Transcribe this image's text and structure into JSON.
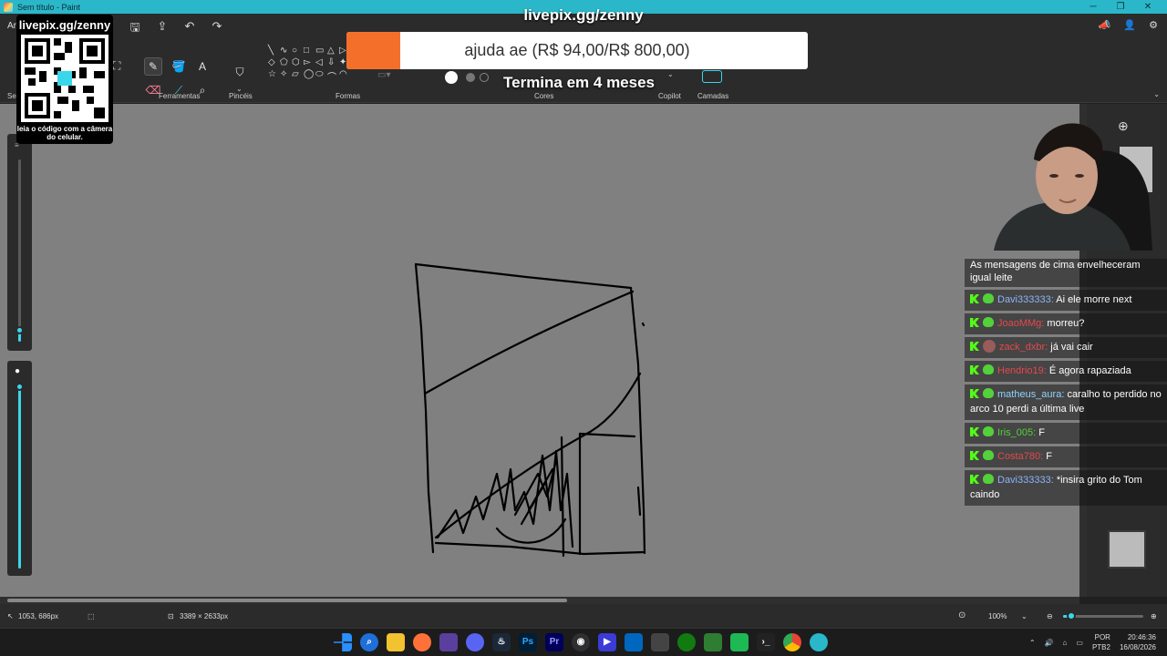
{
  "window": {
    "title": "Sem título - Paint",
    "minimize": "─",
    "maximize": "❐",
    "close": "✕"
  },
  "ribbon": {
    "file_menu_fragment": "Ar",
    "select_label_fragment": "Sel",
    "groups": {
      "tools": "Ferramentas",
      "brushes": "Pincéis",
      "shapes": "Formas",
      "colors": "Cores",
      "copilot": "Copilot",
      "layers": "Camadas"
    },
    "shape_glyphs": [
      "╲",
      "∿",
      "○",
      "□",
      "▭",
      "△",
      "▷",
      "◇",
      "⬠",
      "⬡",
      "▻",
      "◁",
      "⇩",
      "✦",
      "☆",
      "✧",
      "▱",
      "◯",
      "⬭",
      "⌒",
      "◠"
    ]
  },
  "qr_overlay": {
    "url": "livepix.gg/zenny",
    "caption": "leia o código com a câmera do celular."
  },
  "donation": {
    "url": "livepix.gg/zenny",
    "goal_text": "ajuda ae (R$ 94,00/R$ 800,00)",
    "progress_fraction": 0.1175,
    "timer": "Termina em 4 meses"
  },
  "chat": {
    "pinned_top": "As mensagens de cima envelheceram igual leite",
    "messages": [
      {
        "user": "Davi333333",
        "text": " Ai ele morre next",
        "color": "#8ab4f8",
        "icon": "heart"
      },
      {
        "user": "JoaoMMg",
        "text": " morreu?",
        "color": "#e5484d",
        "icon": "heart"
      },
      {
        "user": "zack_dxbr",
        "text": " já vai cair",
        "color": "#e5484d",
        "icon": "avatar"
      },
      {
        "user": "Hendrio19",
        "text": " É agora rapaziada",
        "color": "#e5484d",
        "icon": "heart"
      },
      {
        "user": "matheus_aura",
        "text": " caralho to perdido no arco 10 perdi a última live",
        "color": "#8fd3ff",
        "icon": "heart"
      },
      {
        "user": "Iris_005",
        "text": " F",
        "color": "#53d13a",
        "icon": "heart"
      },
      {
        "user": "Costa780",
        "text": " F",
        "color": "#e5484d",
        "icon": "heart"
      },
      {
        "user": "Davi333333",
        "text": " *insira grito do Tom caindo",
        "color": "#8ab4f8",
        "icon": "heart"
      }
    ]
  },
  "status": {
    "cursor_position": "1053, 686px",
    "canvas_size": "3389 × 2633px",
    "zoom": "100%",
    "zoom_fraction": 0.1
  },
  "taskbar": {
    "language": "POR",
    "layout": "PTB2",
    "time": "20:46:36",
    "date": "16/08/2026"
  },
  "colors": {
    "accent": "#3ad7ea",
    "titlebar": "#2ab7c9",
    "donation_fill": "#f4702a"
  }
}
